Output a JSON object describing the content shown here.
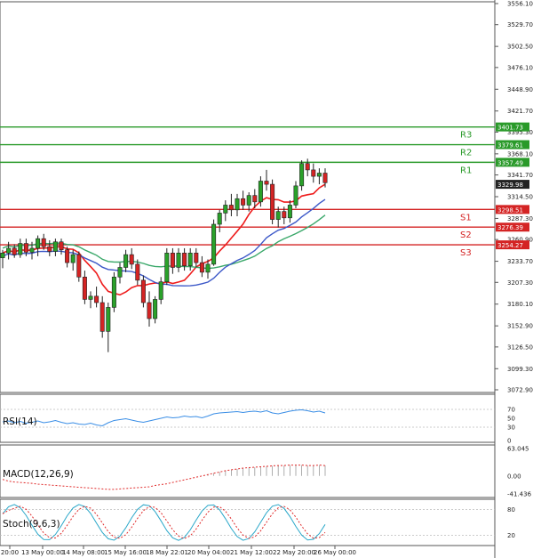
{
  "chart_data": {
    "type": "candlestick",
    "main_panel": {
      "y_ticks": [
        3556.1,
        3529.7,
        3502.5,
        3476.1,
        3448.9,
        3421.7,
        3395.3,
        3368.1,
        3341.7,
        3314.5,
        3287.3,
        3260.9,
        3233.7,
        3207.3,
        3180.1,
        3152.9,
        3126.5,
        3099.3,
        3072.9
      ],
      "ylim": [
        3072.9,
        3556.1
      ],
      "current_price": 3329.98,
      "resistance": [
        {
          "name": "R3",
          "value": 3401.73
        },
        {
          "name": "R2",
          "value": 3379.61
        },
        {
          "name": "R1",
          "value": 3357.49
        }
      ],
      "support": [
        {
          "name": "S1",
          "value": 3298.51
        },
        {
          "name": "S2",
          "value": 3276.39
        },
        {
          "name": "S3",
          "value": 3254.27
        }
      ],
      "candles": [
        [
          3238,
          3248,
          3225,
          3244
        ],
        [
          3244,
          3258,
          3236,
          3250
        ],
        [
          3250,
          3255,
          3238,
          3242
        ],
        [
          3242,
          3262,
          3238,
          3256
        ],
        [
          3256,
          3262,
          3240,
          3245
        ],
        [
          3245,
          3258,
          3236,
          3250
        ],
        [
          3250,
          3266,
          3240,
          3262
        ],
        [
          3262,
          3268,
          3248,
          3252
        ],
        [
          3252,
          3260,
          3240,
          3246
        ],
        [
          3246,
          3262,
          3240,
          3258
        ],
        [
          3258,
          3262,
          3242,
          3248
        ],
        [
          3248,
          3252,
          3226,
          3232
        ],
        [
          3232,
          3248,
          3222,
          3242
        ],
        [
          3242,
          3246,
          3208,
          3214
        ],
        [
          3214,
          3222,
          3180,
          3186
        ],
        [
          3186,
          3196,
          3175,
          3190
        ],
        [
          3190,
          3202,
          3176,
          3182
        ],
        [
          3182,
          3190,
          3138,
          3146
        ],
        [
          3146,
          3182,
          3120,
          3176
        ],
        [
          3176,
          3220,
          3170,
          3214
        ],
        [
          3214,
          3232,
          3206,
          3226
        ],
        [
          3226,
          3248,
          3220,
          3242
        ],
        [
          3242,
          3250,
          3224,
          3230
        ],
        [
          3230,
          3236,
          3204,
          3210
        ],
        [
          3210,
          3216,
          3176,
          3182
        ],
        [
          3182,
          3196,
          3152,
          3162
        ],
        [
          3162,
          3190,
          3156,
          3186
        ],
        [
          3186,
          3214,
          3180,
          3208
        ],
        [
          3208,
          3250,
          3204,
          3244
        ],
        [
          3244,
          3250,
          3218,
          3226
        ],
        [
          3226,
          3250,
          3220,
          3244
        ],
        [
          3244,
          3250,
          3222,
          3228
        ],
        [
          3228,
          3250,
          3222,
          3244
        ],
        [
          3244,
          3250,
          3226,
          3232
        ],
        [
          3232,
          3240,
          3214,
          3220
        ],
        [
          3220,
          3236,
          3212,
          3230
        ],
        [
          3230,
          3286,
          3228,
          3280
        ],
        [
          3280,
          3298,
          3270,
          3294
        ],
        [
          3294,
          3310,
          3284,
          3304
        ],
        [
          3304,
          3318,
          3290,
          3298
        ],
        [
          3298,
          3318,
          3290,
          3312
        ],
        [
          3312,
          3322,
          3298,
          3304
        ],
        [
          3304,
          3320,
          3296,
          3316
        ],
        [
          3316,
          3324,
          3300,
          3308
        ],
        [
          3308,
          3340,
          3302,
          3334
        ],
        [
          3334,
          3348,
          3322,
          3330
        ],
        [
          3330,
          3336,
          3280,
          3286
        ],
        [
          3286,
          3302,
          3276,
          3296
        ],
        [
          3296,
          3302,
          3280,
          3288
        ],
        [
          3288,
          3310,
          3282,
          3304
        ],
        [
          3304,
          3334,
          3300,
          3328
        ],
        [
          3328,
          3360,
          3322,
          3356
        ],
        [
          3356,
          3362,
          3340,
          3348
        ],
        [
          3348,
          3356,
          3332,
          3340
        ],
        [
          3340,
          3350,
          3330,
          3344
        ],
        [
          3344,
          3350,
          3326,
          3332
        ]
      ]
    },
    "rsi": {
      "label": "RSI(14)",
      "y_ticks": [
        70,
        50,
        30,
        0
      ]
    },
    "macd": {
      "label": "MACD(12,26,9)",
      "y_ticks": [
        63.045,
        0.0,
        -41.436
      ]
    },
    "stoch": {
      "label": "Stoch(9,6,3)",
      "y_ticks": [
        80,
        20
      ]
    },
    "x_labels": [
      "20:00",
      "13 May 00:00",
      "14 May 08:00",
      "15 May 16:00",
      "18 May 22:01",
      "20 May 04:00",
      "21 May 12:00",
      "22 May 20:00",
      "26 May 00:00"
    ],
    "colors": {
      "bull": "#2aa12a",
      "bear": "#d42424",
      "red_ma": "#ee1c1c",
      "green_ma": "#3aa86a",
      "blue_ma": "#3c58c8",
      "resistance": "#2a9a2a",
      "support": "#d42424",
      "rsi": "#3a8ee6",
      "stoch_k": "#2aa7c9",
      "stoch_d": "#e02a2a"
    }
  }
}
